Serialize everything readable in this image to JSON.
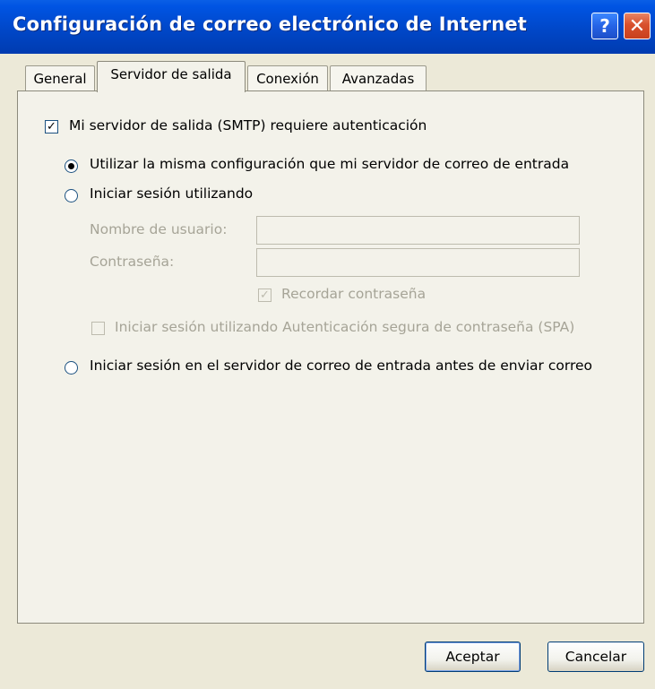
{
  "window": {
    "title": "Configuración de correo electrónico de Internet",
    "help_button": "?",
    "close_button": "✕"
  },
  "tabs": [
    {
      "label": "General",
      "active": false
    },
    {
      "label": "Servidor de salida",
      "active": true
    },
    {
      "label": "Conexión",
      "active": false
    },
    {
      "label": "Avanzadas",
      "active": false
    }
  ],
  "smtp": {
    "requires_auth_label": "Mi servidor de salida (SMTP) requiere autenticación",
    "requires_auth_checked": true,
    "radio_same_config_label": "Utilizar la misma configuración que mi servidor de correo de entrada",
    "radio_same_config_selected": true,
    "radio_login_using_label": "Iniciar sesión utilizando",
    "username_label": "Nombre de usuario:",
    "username_value": "",
    "password_label": "Contraseña:",
    "password_value": "",
    "remember_password_label": "Recordar contraseña",
    "remember_password_checked": true,
    "spa_label": "Iniciar sesión utilizando Autenticación segura de contraseña (SPA)",
    "spa_checked": false,
    "radio_login_before_label": "Iniciar sesión en el servidor de correo de entrada antes de enviar correo"
  },
  "buttons": {
    "ok": "Aceptar",
    "cancel": "Cancelar"
  },
  "check_glyph": "✓"
}
